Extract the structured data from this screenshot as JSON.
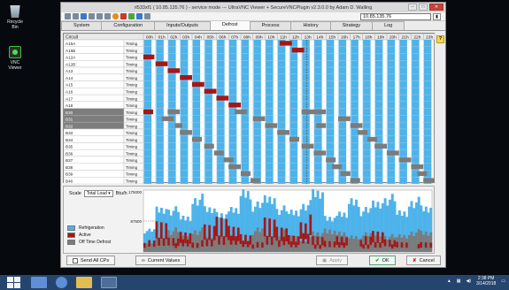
{
  "desktop": {
    "recycle_bin": "Recycle Bin",
    "vnc_viewer": "VNC Viewer"
  },
  "window": {
    "title": "rl533xf1 ( 10.85.135.76 ) - service mode --- UltraVNC Viewer + SecureVNCPlugin v2.3.0.0 by Adam D. Walling",
    "address": "10.85.135.76",
    "minimize": "–",
    "maximize": "□",
    "close": "✕"
  },
  "tabs": [
    "System",
    "Configuration",
    "Inputs/Outputs",
    "Defrost",
    "Process",
    "History",
    "Strategy",
    "Log"
  ],
  "active_tab": 3,
  "grid": {
    "header": "Circuit",
    "hours": [
      "00h",
      "01h",
      "02h",
      "03h",
      "04h",
      "05h",
      "06h",
      "07h",
      "08h",
      "09h",
      "10h",
      "11h",
      "12h",
      "13h",
      "14h",
      "15h",
      "16h",
      "17h",
      "18h",
      "19h",
      "20h",
      "21h",
      "22h",
      "23h"
    ],
    "circuits": [
      "A15A",
      "A15B",
      "A12A",
      "A12B",
      "A13",
      "A14",
      "A15",
      "A16",
      "A17",
      "A18",
      "B30",
      "B31",
      "B32",
      "B33",
      "B34",
      "B35",
      "B36",
      "B37",
      "B38",
      "B39",
      "B40"
    ],
    "defrost_type": "Timing",
    "highlighted_rows": [
      10,
      11,
      12
    ]
  },
  "chart": {
    "scale_label": "Scale",
    "scale_value": "Total Load",
    "scale_unit": "Btu/h",
    "y_top": "175000",
    "y_mid": "87500",
    "legend": [
      {
        "label": "Refrigeration",
        "color": "#4db3ea"
      },
      {
        "label": "Active",
        "color": "#a51717"
      },
      {
        "label": "Off Time Defrost",
        "color": "#7b7b7b"
      }
    ]
  },
  "buttons": {
    "send_all": "Send All CPs",
    "current_values": "Current Values",
    "apply": "Apply",
    "ok": "OK",
    "cancel": "Cancel"
  },
  "taskbar": {
    "time": "2:38 PM",
    "date": "3/14/2018"
  },
  "colors": {
    "refrigeration": "#4db3ea",
    "active": "#a51717",
    "off_time": "#7b7b7b",
    "grid_bg": "#ffffff",
    "highlight_row": "#7d7d7d"
  },
  "chart_data": {
    "type": "area",
    "title": "",
    "xlabel": "",
    "ylabel": "Total Load (Btu/h)",
    "ylim": [
      0,
      175000
    ],
    "x": [
      0,
      1,
      2,
      3,
      4,
      5,
      6,
      7,
      8,
      9,
      10,
      11,
      12,
      13,
      14,
      15,
      16,
      17,
      18,
      19,
      20,
      21,
      22,
      23
    ],
    "series": [
      {
        "name": "Refrigeration",
        "values": [
          60000,
          120000,
          118000,
          96000,
          150000,
          118000,
          108000,
          116000,
          170000,
          130000,
          150000,
          120000,
          112000,
          134000,
          162000,
          98000,
          104000,
          146000,
          116000,
          136000,
          150000,
          110000,
          142000,
          120000
        ]
      },
      {
        "name": "Active",
        "values": [
          30000,
          80000,
          40000,
          60000,
          30000,
          70000,
          95000,
          75000,
          55000,
          25000,
          90000,
          70000,
          50000,
          95000,
          40000,
          30000,
          45000,
          20000,
          40000,
          55000,
          35000,
          30000,
          20000,
          25000
        ]
      },
      {
        "name": "Off Time Defrost",
        "values": [
          25000,
          45000,
          60000,
          42000,
          60000,
          45000,
          55000,
          40000,
          30000,
          60000,
          45000,
          55000,
          42000,
          36000,
          50000,
          62000,
          50000,
          44000,
          48000,
          52000,
          44000,
          45000,
          56000,
          52000
        ]
      }
    ]
  }
}
